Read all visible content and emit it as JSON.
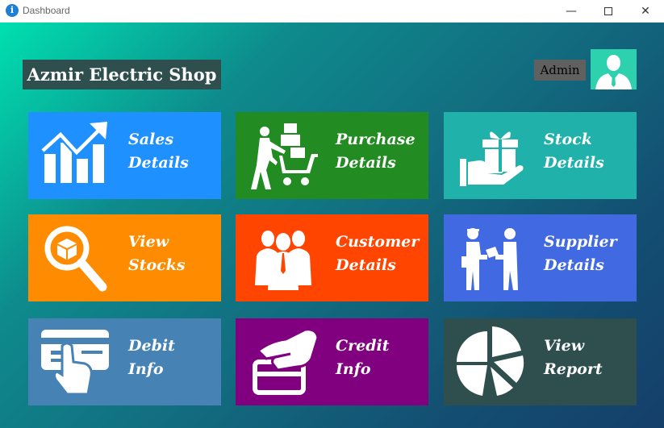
{
  "window": {
    "title": "Dashboard",
    "icon_glyph": "i",
    "minimize_glyph": "—",
    "close_glyph": "✕"
  },
  "header": {
    "shop_name": "Azmir Electric Shop",
    "user_label": "Admin"
  },
  "tiles": [
    {
      "line1": "Sales",
      "line2": "Details",
      "color": "#1e90ff",
      "icon": "sales-chart-icon"
    },
    {
      "line1": "Purchase",
      "line2": "Details",
      "color": "#228b22",
      "icon": "shopping-cart-icon"
    },
    {
      "line1": "Stock",
      "line2": "Details",
      "color": "#20b2aa",
      "icon": "gift-hand-icon"
    },
    {
      "line1": "View",
      "line2": "Stocks",
      "color": "#ff8c00",
      "icon": "magnifier-box-icon"
    },
    {
      "line1": "Customer",
      "line2": "Details",
      "color": "#ff4500",
      "icon": "people-group-icon"
    },
    {
      "line1": "Supplier",
      "line2": "Details",
      "color": "#4169e1",
      "icon": "delivery-handover-icon"
    },
    {
      "line1": "Debit",
      "line2": "Info",
      "color": "#4682b4",
      "icon": "card-hand-icon"
    },
    {
      "line1": "Credit",
      "line2": "Info",
      "color": "#800080",
      "icon": "hand-card-icon"
    },
    {
      "line1": "View",
      "line2": "Report",
      "color": "#2f4f4f",
      "icon": "pie-chart-icon"
    }
  ]
}
